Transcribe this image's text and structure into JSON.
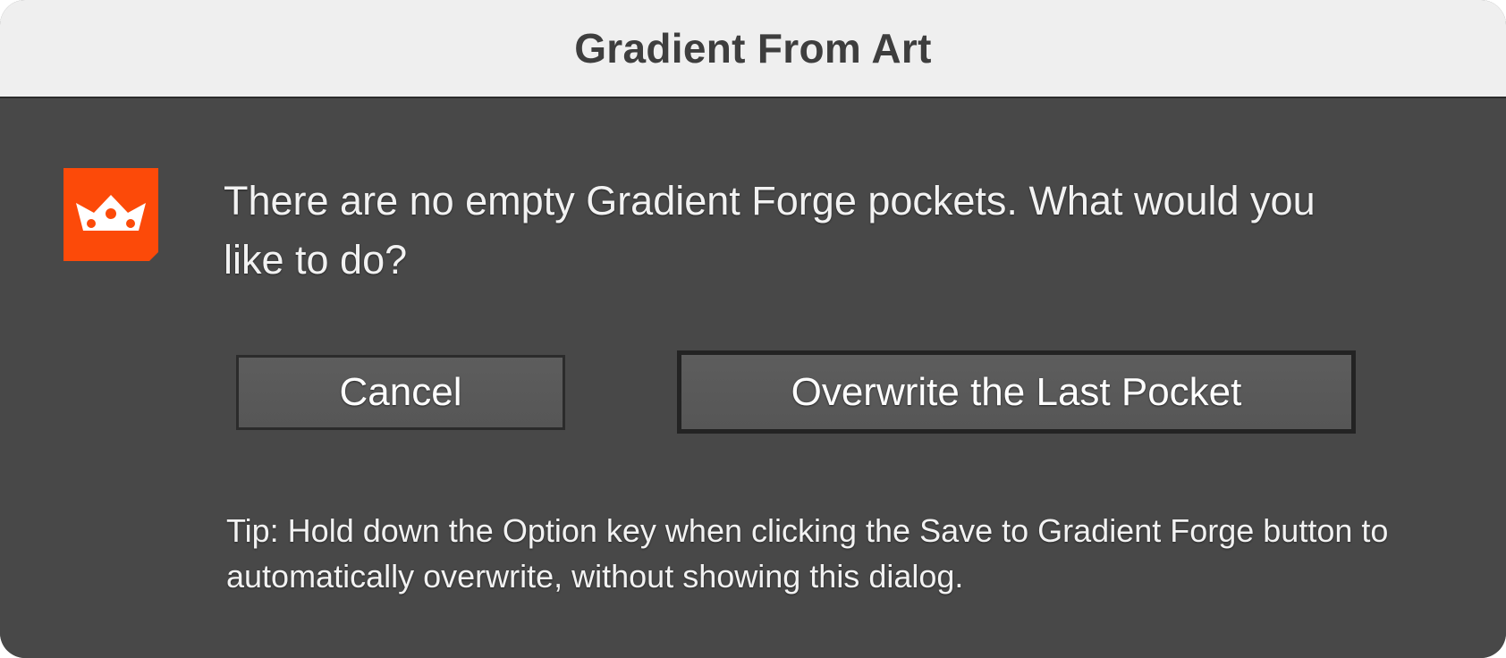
{
  "dialog": {
    "title": "Gradient From Art",
    "message": "There are no empty Gradient Forge pockets. What would you like to do?",
    "tip": "Tip: Hold down the Option key when clicking the Save to Gradient Forge button to automatically overwrite, without showing this dialog."
  },
  "buttons": {
    "cancel_label": "Cancel",
    "overwrite_label": "Overwrite the Last Pocket"
  },
  "icons": {
    "app_icon": "crown-icon"
  },
  "colors": {
    "app_icon_background": "#fc4a09",
    "dialog_background": "#484848",
    "titlebar_background": "#efefef"
  }
}
